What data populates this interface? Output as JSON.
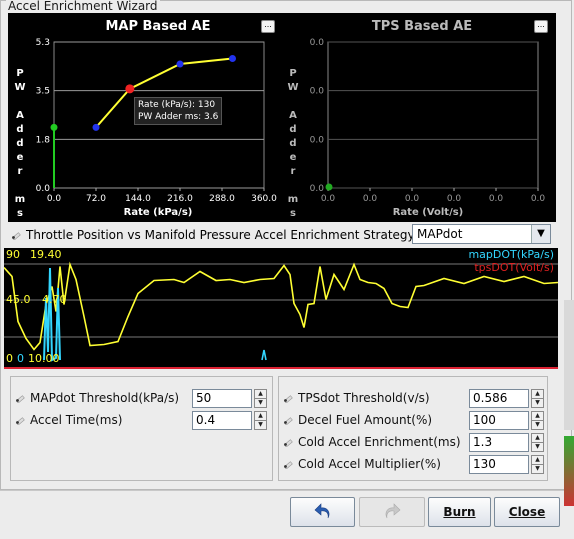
{
  "window": {
    "title": "Accel Enrichment Wizard"
  },
  "map_chart": {
    "title": "MAP Based AE",
    "ylabel_letters": [
      "P",
      "W",
      "",
      "A",
      "d",
      "d",
      "e",
      "r",
      "",
      "m",
      "s"
    ],
    "xlabel": "Rate (kPa/s)",
    "yticks": [
      "5.3",
      "3.5",
      "1.8",
      "0.0"
    ],
    "xticks": [
      "0.0",
      "72.0",
      "144.0",
      "216.0",
      "288.0",
      "360.0"
    ],
    "menu_label": "...",
    "tooltip": {
      "line1": "Rate (kPa/s): 130",
      "line2": "PW Adder ms: 3.6"
    }
  },
  "tps_chart": {
    "title": "TPS Based AE",
    "ylabel_letters": [
      "P",
      "W",
      "",
      "A",
      "d",
      "d",
      "e",
      "r",
      "",
      "m",
      "s"
    ],
    "xlabel": "Rate (Volt/s)",
    "yticks": [
      "0.0",
      "0.0",
      "0.0",
      "0.0"
    ],
    "xticks": [
      "0.0",
      "0.0",
      "0.0",
      "0.0",
      "0.0",
      "0.0"
    ],
    "menu_label": "..."
  },
  "chart_data": [
    {
      "type": "line",
      "title": "MAP Based AE",
      "xlabel": "Rate (kPa/s)",
      "ylabel": "PW Adder ms",
      "xlim": [
        0,
        360
      ],
      "ylim": [
        0,
        5.3
      ],
      "grid": true,
      "series": [
        {
          "x": [
            0,
            72,
            130,
            216,
            306
          ],
          "y": [
            2.2,
            2.2,
            3.6,
            4.5,
            4.7
          ]
        }
      ],
      "highlight_point": {
        "x": 130,
        "y": 3.6
      }
    },
    {
      "type": "line",
      "title": "TPS Based AE",
      "xlabel": "Rate (Volt/s)",
      "ylabel": "PW Adder ms",
      "xlim": [
        0,
        0
      ],
      "ylim": [
        0,
        0
      ],
      "grid": true,
      "series": [
        {
          "x": [
            0
          ],
          "y": [
            0
          ]
        }
      ]
    }
  ],
  "strategy": {
    "label": "Throttle Position vs Manifold Pressure Accel Enrichment Strategy",
    "selected": "MAPdot"
  },
  "scope": {
    "legend": [
      {
        "name": "mapDOT(kPa/s)",
        "color": "#33d6ff"
      },
      {
        "name": "tpsDOT(Volt/s)",
        "color": "#e02020"
      }
    ],
    "yellow_color": "#ffff33",
    "cyan_color": "#33d6ff",
    "labels": {
      "top_left": "90",
      "top_right": "19.40",
      "mid_left": "45.0",
      "mid_right": "4.70",
      "bot_left": "0",
      "bot_mid": "0",
      "bot_right": "10.00"
    }
  },
  "left_settings": [
    {
      "label": "MAPdot Threshold(kPa/s)",
      "value": "50"
    },
    {
      "label": "Accel Time(ms)",
      "value": "0.4"
    }
  ],
  "right_settings": [
    {
      "label": "TPSdot Threshold(v/s)",
      "value": "0.586"
    },
    {
      "label": "Decel Fuel Amount(%)",
      "value": "100"
    },
    {
      "label": "Cold Accel Enrichment(ms)",
      "value": "1.3"
    },
    {
      "label": "Cold Accel Multiplier(%)",
      "value": "130"
    }
  ],
  "buttons": {
    "undo_icon": "undo-arrow-icon",
    "redo_icon": "redo-arrow-icon",
    "burn": "Burn",
    "close": "Close"
  }
}
